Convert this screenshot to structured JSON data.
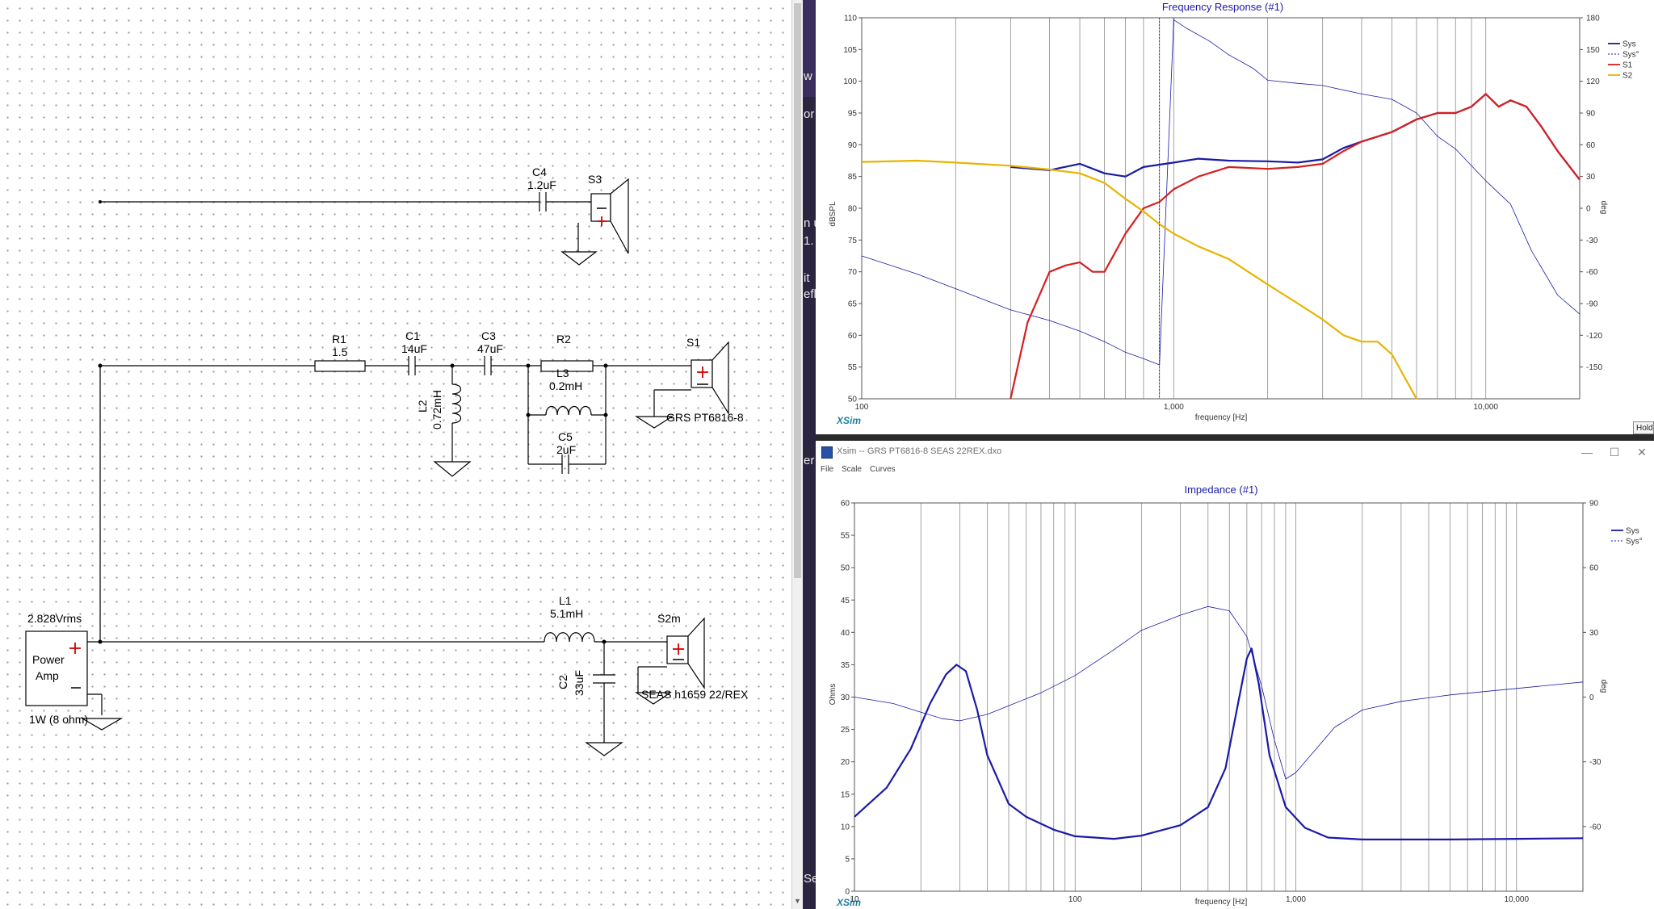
{
  "schematic": {
    "c4": {
      "name": "C4",
      "value": "1.2uF"
    },
    "s3": {
      "name": "S3"
    },
    "r1": {
      "name": "R1",
      "value": "1.5"
    },
    "c1": {
      "name": "C1",
      "value": "14uF"
    },
    "c3": {
      "name": "C3",
      "value": "47uF"
    },
    "r2": {
      "name": "R2"
    },
    "l3": {
      "name": "L3",
      "value": "0.2mH"
    },
    "l2": {
      "name": "L2",
      "value": "0.72mH"
    },
    "c5": {
      "name": "C5",
      "value": "2uF"
    },
    "s1": {
      "name": "S1",
      "model": "GRS PT6816-8"
    },
    "l1": {
      "name": "L1",
      "value": "5.1mH"
    },
    "c2": {
      "name": "C2",
      "value": "33uF"
    },
    "s2m": {
      "name": "S2m",
      "model": "SEAS h1659 22/REX"
    },
    "amp": {
      "voltage": "2.828Vrms",
      "label_line1": "Power",
      "label_line2": "Amp",
      "rating": "1W (8 ohm)"
    }
  },
  "background_strip": {
    "fragments": [
      {
        "text": "w",
        "y": 0
      },
      {
        "text": "or",
        "y": 0
      },
      {
        "text": "n u",
        "y": 0
      },
      {
        "text": "1.",
        "y": 0
      },
      {
        "text": "it",
        "y": 0
      },
      {
        "text": "efl",
        "y": 0
      },
      {
        "text": "er",
        "y": 0
      },
      {
        "text": "Se",
        "y": 0
      }
    ]
  },
  "freq_chart": {
    "title": "Frequency Response (#1)",
    "ylabel": "dBSPL",
    "y2label": "deg",
    "xlabel": "frequency [Hz]",
    "brand": "XSim",
    "x_ticks": [
      "100",
      "1,000",
      "10,000"
    ],
    "y_ticks": [
      "110",
      "105",
      "100",
      "95",
      "90",
      "85",
      "80",
      "75",
      "70",
      "65",
      "60",
      "55",
      "50"
    ],
    "y2_ticks": [
      "180",
      "150",
      "120",
      "90",
      "60",
      "30",
      "0",
      "-30",
      "-60",
      "-90",
      "-120",
      "-150"
    ],
    "legend": [
      "Sys",
      "Sys°",
      "S1",
      "S2"
    ],
    "colors": {
      "sys": "#1a1aa6",
      "s1": "#d42020",
      "s2": "#e8b400",
      "grid": "#8c8c8c"
    }
  },
  "chart_data": [
    {
      "type": "line",
      "title": "Frequency Response (#1)",
      "xlabel": "frequency [Hz]",
      "ylabel": "dBSPL",
      "y2label": "deg",
      "xscale": "log",
      "xlim": [
        100,
        20000
      ],
      "ylim": [
        50,
        110
      ],
      "y2lim": [
        -180,
        180
      ],
      "legend_position": "top-right",
      "series": [
        {
          "name": "Sys",
          "axis": "left",
          "points": [
            [
              300,
              86.5
            ],
            [
              400,
              86
            ],
            [
              500,
              87
            ],
            [
              600,
              85.5
            ],
            [
              700,
              85
            ],
            [
              800,
              86.5
            ],
            [
              1000,
              87.2
            ],
            [
              1200,
              87.8
            ],
            [
              1500,
              87.5
            ],
            [
              2000,
              87.4
            ],
            [
              2500,
              87.2
            ],
            [
              3000,
              87.7
            ],
            [
              3500,
              89.5
            ],
            [
              4000,
              90.5
            ],
            [
              5000,
              92
            ],
            [
              6000,
              94
            ],
            [
              7000,
              95
            ],
            [
              8000,
              95
            ],
            [
              9000,
              96
            ],
            [
              10000,
              98
            ],
            [
              11000,
              96
            ],
            [
              12000,
              97
            ],
            [
              13500,
              96
            ],
            [
              15000,
              93
            ],
            [
              17000,
              89
            ],
            [
              20000,
              84.5
            ]
          ]
        },
        {
          "name": "Sys°",
          "axis": "right",
          "points": [
            [
              100,
              -45
            ],
            [
              150,
              -62
            ],
            [
              200,
              -76
            ],
            [
              300,
              -96
            ],
            [
              400,
              -106
            ],
            [
              500,
              -116
            ],
            [
              600,
              -126
            ],
            [
              700,
              -136
            ],
            [
              800,
              -142
            ],
            [
              900,
              -148
            ],
            [
              1000,
              178
            ],
            [
              1100,
              170
            ],
            [
              1300,
              158
            ],
            [
              1500,
              145
            ],
            [
              1800,
              132
            ],
            [
              2000,
              121
            ],
            [
              2500,
              118
            ],
            [
              3000,
              116
            ],
            [
              4000,
              108
            ],
            [
              5000,
              103
            ],
            [
              6000,
              90
            ],
            [
              7000,
              68
            ],
            [
              8000,
              56
            ],
            [
              10000,
              26
            ],
            [
              12000,
              4
            ],
            [
              14000,
              -40
            ],
            [
              17000,
              -82
            ],
            [
              20000,
              -100
            ]
          ]
        },
        {
          "name": "S1",
          "axis": "left",
          "points": [
            [
              300,
              50
            ],
            [
              340,
              62
            ],
            [
              400,
              70
            ],
            [
              450,
              71
            ],
            [
              500,
              71.5
            ],
            [
              550,
              70
            ],
            [
              600,
              70
            ],
            [
              700,
              76
            ],
            [
              800,
              80
            ],
            [
              900,
              81
            ],
            [
              1000,
              83
            ],
            [
              1200,
              85
            ],
            [
              1500,
              86.5
            ],
            [
              2000,
              86.2
            ],
            [
              2500,
              86.5
            ],
            [
              3000,
              87
            ],
            [
              3500,
              89
            ],
            [
              4000,
              90.5
            ],
            [
              5000,
              92
            ],
            [
              6000,
              94
            ],
            [
              7000,
              95
            ],
            [
              8000,
              95
            ],
            [
              9000,
              96
            ],
            [
              10000,
              98
            ],
            [
              11000,
              96
            ],
            [
              12000,
              97
            ],
            [
              13500,
              96
            ],
            [
              15000,
              93
            ],
            [
              17000,
              89
            ],
            [
              20000,
              84.5
            ]
          ]
        },
        {
          "name": "S2",
          "axis": "left",
          "points": [
            [
              100,
              87.3
            ],
            [
              150,
              87.5
            ],
            [
              200,
              87.2
            ],
            [
              300,
              86.7
            ],
            [
              400,
              86.1
            ],
            [
              500,
              85.5
            ],
            [
              600,
              84
            ],
            [
              700,
              81.5
            ],
            [
              800,
              79.5
            ],
            [
              900,
              77.5
            ],
            [
              1000,
              76
            ],
            [
              1200,
              74
            ],
            [
              1500,
              72
            ],
            [
              2000,
              68
            ],
            [
              2500,
              65
            ],
            [
              3000,
              62.5
            ],
            [
              3500,
              60
            ],
            [
              4000,
              59
            ],
            [
              4500,
              59
            ],
            [
              5000,
              57
            ],
            [
              6000,
              50
            ]
          ]
        }
      ]
    },
    {
      "type": "line",
      "title": "Impedance (#1)",
      "xlabel": "frequency [Hz]",
      "ylabel": "Ohms",
      "y2label": "deg",
      "xscale": "log",
      "xlim": [
        10,
        20000
      ],
      "ylim": [
        0,
        60
      ],
      "y2lim": [
        -90,
        90
      ],
      "legend_position": "top-right",
      "series": [
        {
          "name": "Sys",
          "axis": "left",
          "points": [
            [
              10,
              11.5
            ],
            [
              14,
              16
            ],
            [
              18,
              22
            ],
            [
              22,
              29
            ],
            [
              26,
              33.5
            ],
            [
              29,
              35
            ],
            [
              32,
              34
            ],
            [
              36,
              28
            ],
            [
              40,
              21
            ],
            [
              50,
              13.5
            ],
            [
              60,
              11.5
            ],
            [
              80,
              9.5
            ],
            [
              100,
              8.5
            ],
            [
              150,
              8.1
            ],
            [
              200,
              8.6
            ],
            [
              300,
              10.2
            ],
            [
              400,
              13
            ],
            [
              480,
              19
            ],
            [
              540,
              28
            ],
            [
              600,
              36
            ],
            [
              630,
              37.5
            ],
            [
              680,
              32
            ],
            [
              760,
              21
            ],
            [
              900,
              13
            ],
            [
              1100,
              9.8
            ],
            [
              1400,
              8.3
            ],
            [
              2000,
              8
            ],
            [
              5000,
              8
            ],
            [
              10000,
              8.1
            ],
            [
              20000,
              8.2
            ]
          ]
        },
        {
          "name": "Sys°",
          "axis": "right",
          "points": [
            [
              10,
              0
            ],
            [
              15,
              -3
            ],
            [
              20,
              -7
            ],
            [
              25,
              -10
            ],
            [
              30,
              -11
            ],
            [
              40,
              -8
            ],
            [
              50,
              -4
            ],
            [
              70,
              2
            ],
            [
              100,
              10
            ],
            [
              150,
              22
            ],
            [
              200,
              31
            ],
            [
              300,
              38
            ],
            [
              400,
              42
            ],
            [
              500,
              40
            ],
            [
              600,
              28
            ],
            [
              700,
              5
            ],
            [
              800,
              -20
            ],
            [
              900,
              -38
            ],
            [
              1000,
              -35
            ],
            [
              1500,
              -14
            ],
            [
              2000,
              -6
            ],
            [
              3000,
              -2
            ],
            [
              5000,
              1
            ],
            [
              10000,
              4
            ],
            [
              20000,
              7
            ]
          ]
        }
      ]
    }
  ],
  "imp_window": {
    "title": "Xsim -- GRS PT6816-8 SEAS 22REX.dxo",
    "menus": [
      "File",
      "Scale",
      "Curves"
    ],
    "win_buttons": [
      "—",
      "☐",
      "✕"
    ]
  },
  "imp_chart": {
    "title": "Impedance (#1)",
    "ylabel": "Ohms",
    "y2label": "deg",
    "xlabel": "frequency [Hz]",
    "brand": "XSim",
    "x_ticks": [
      "10",
      "100",
      "1,000",
      "10,000"
    ],
    "y_ticks": [
      "60",
      "55",
      "50",
      "45",
      "40",
      "35",
      "30",
      "25",
      "20",
      "15",
      "10",
      "5",
      "0"
    ],
    "y2_ticks": [
      "90",
      "60",
      "30",
      "0",
      "-30",
      "-60"
    ],
    "legend": [
      "Sys",
      "Sys°"
    ]
  },
  "hold_button": {
    "label": "Hold"
  }
}
